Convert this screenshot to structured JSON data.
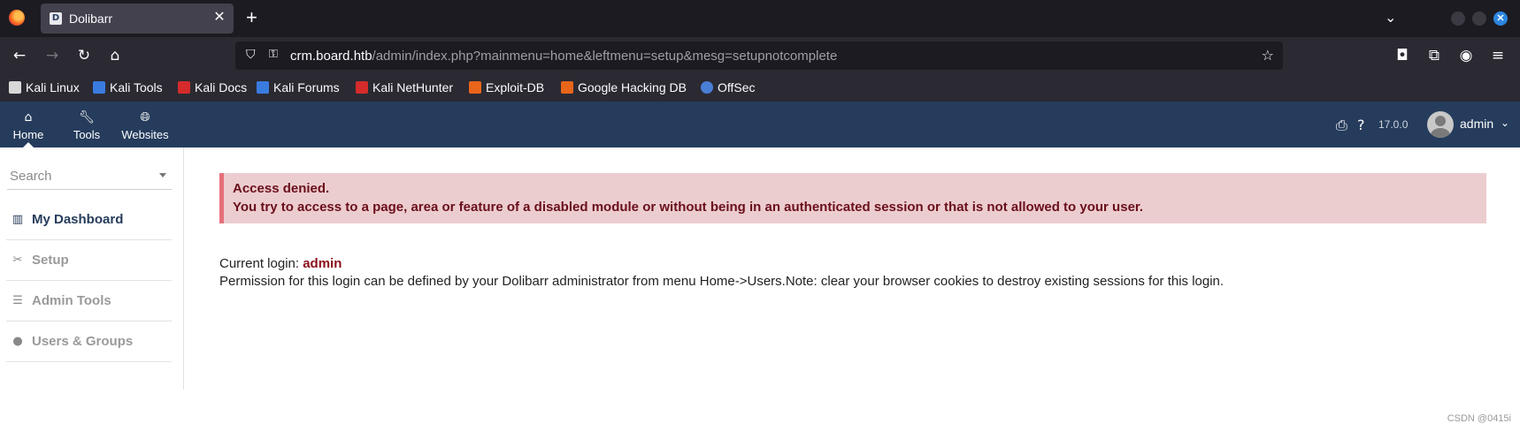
{
  "browser": {
    "tab_title": "Dolibarr",
    "tab_favicon": "D",
    "url_host": "crm.board.htb",
    "url_path": "/admin/index.php?mainmenu=home&leftmenu=setup&mesg=setupnotcomplete",
    "bookmarks": [
      {
        "label": "Kali Linux",
        "icon": "kali-dragon-icon",
        "color": "#d8d8d8"
      },
      {
        "label": "Kali Tools",
        "icon": "kali-tools-icon",
        "color": "#3a7be0"
      },
      {
        "label": "Kali Docs",
        "icon": "kali-docs-icon",
        "color": "#d52b2b"
      },
      {
        "label": "Kali Forums",
        "icon": "kali-forums-icon",
        "color": "#3a7be0"
      },
      {
        "label": "Kali NetHunter",
        "icon": "nethunter-icon",
        "color": "#d52b2b"
      },
      {
        "label": "Exploit-DB",
        "icon": "exploit-db-icon",
        "color": "#e8651a"
      },
      {
        "label": "Google Hacking DB",
        "icon": "ghdb-icon",
        "color": "#e8651a"
      },
      {
        "label": "OffSec",
        "icon": "offsec-icon",
        "color": "#4a7fd8"
      }
    ]
  },
  "app": {
    "menu": [
      {
        "label": "Home",
        "icon": "home-icon"
      },
      {
        "label": "Tools",
        "icon": "wrench-icon"
      },
      {
        "label": "Websites",
        "icon": "globe-icon"
      }
    ],
    "version": "17.0.0",
    "user": "admin",
    "brand_color": "#263c5c"
  },
  "sidebar": {
    "search_placeholder": "Search",
    "items": [
      {
        "label": "My Dashboard",
        "icon": "chart-icon"
      },
      {
        "label": "Setup",
        "icon": "tools-icon"
      },
      {
        "label": "Admin Tools",
        "icon": "server-icon"
      },
      {
        "label": "Users & Groups",
        "icon": "user-icon"
      }
    ]
  },
  "error": {
    "title": "Access denied.",
    "message": "You try to access to a page, area or feature of a disabled module or without being in an authenticated session or that is not allowed to your user."
  },
  "info": {
    "current_login_label": "Current login:",
    "current_login_user": "admin",
    "permission_text": "Permission for this login can be defined by your Dolibarr administrator from menu Home->Users.Note: clear your browser cookies to destroy existing sessions for this login."
  },
  "watermark": "CSDN @0415i"
}
